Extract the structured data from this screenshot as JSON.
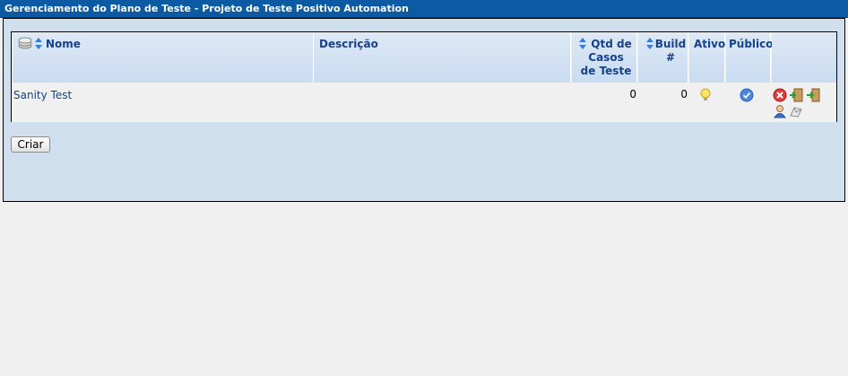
{
  "window": {
    "title": "Gerenciamento do Plano de Teste - Projeto de Teste Positivo Automation"
  },
  "table": {
    "columns": {
      "name": "Nome",
      "description": "Descrição",
      "test_cases_line1": "Qtd de",
      "test_cases_line2": "Casos",
      "test_cases_line3": "de Teste",
      "build_line1": "Build",
      "build_line2": "#",
      "active": "Ativo",
      "public": "Público"
    },
    "rows": [
      {
        "name": "Sanity Test",
        "description": "",
        "test_cases": "0",
        "builds": "0"
      }
    ]
  },
  "icons": {
    "header": [
      "toggle-columns-icon",
      "sort-icon"
    ],
    "row": [
      "active-bulb-icon",
      "public-check-icon",
      "delete-icon",
      "export-icon",
      "import-icon",
      "assign-users-icon",
      "milestones-icon"
    ]
  },
  "buttons": {
    "create": "Criar"
  },
  "colors": {
    "title_bar": "#0b5aa3",
    "panel": "#cfdfee",
    "header_text": "#15428b"
  }
}
